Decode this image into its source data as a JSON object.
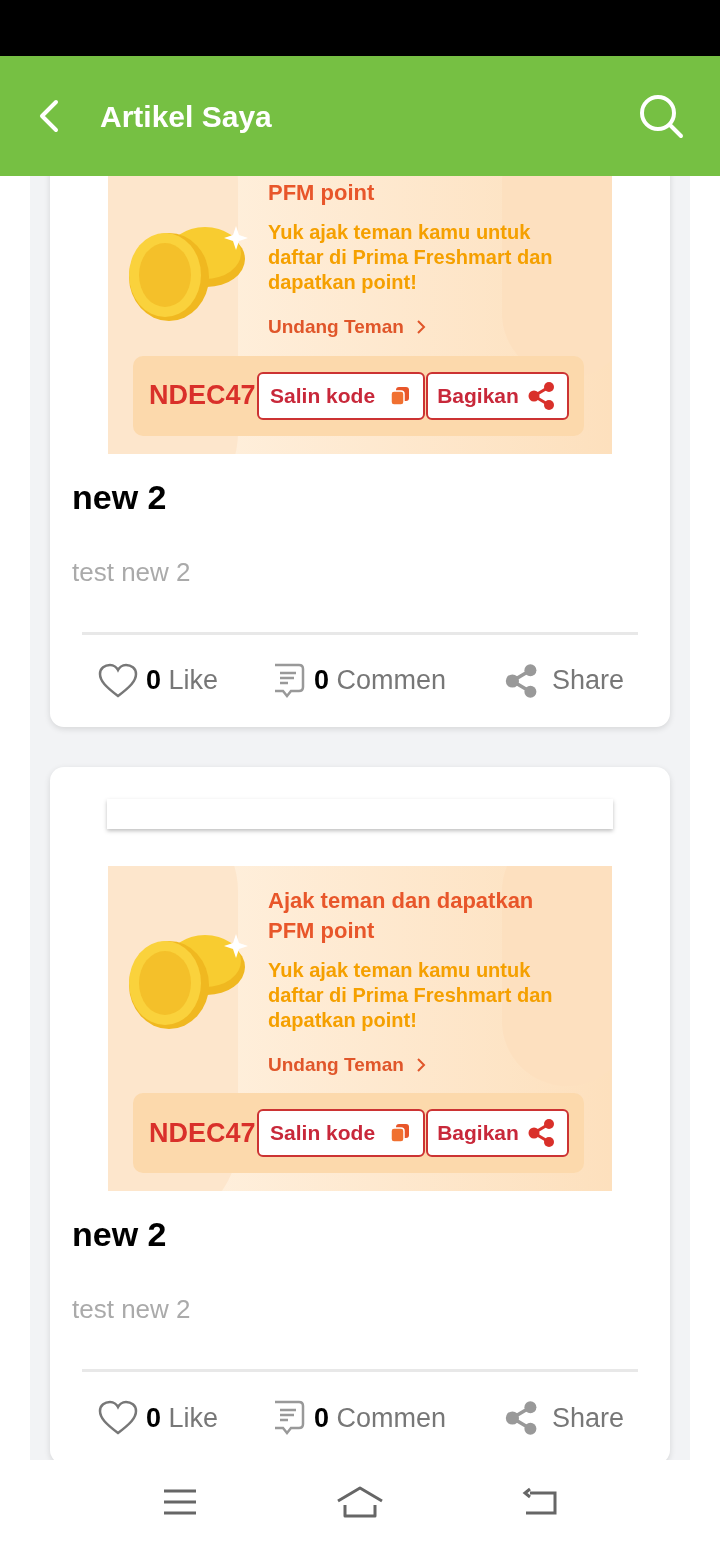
{
  "header": {
    "title": "Artikel Saya"
  },
  "articles": [
    {
      "blank_image": false,
      "banner": {
        "title": "PFM point",
        "text": "Yuk ajak teman kamu untuk daftar di Prima Freshmart dan dapatkan point!",
        "link": "Undang Teman",
        "code": "NDEC47",
        "copy_button": "Salin kode",
        "share_button": "Bagikan"
      },
      "title": "new 2",
      "description": "test new 2",
      "likes": "0",
      "like_label": "Like",
      "comments": "0",
      "comment_label": "Commen",
      "share_label": "Share"
    },
    {
      "blank_image": true,
      "banner": {
        "title": "Ajak teman dan dapatkan PFM point",
        "text": "Yuk ajak teman kamu untuk daftar di Prima Freshmart dan dapatkan point!",
        "link": "Undang Teman",
        "code": "NDEC47",
        "copy_button": "Salin kode",
        "share_button": "Bagikan"
      },
      "title": "new 2",
      "description": "test new 2",
      "likes": "0",
      "like_label": "Like",
      "comments": "0",
      "comment_label": "Commen",
      "share_label": "Share"
    }
  ]
}
